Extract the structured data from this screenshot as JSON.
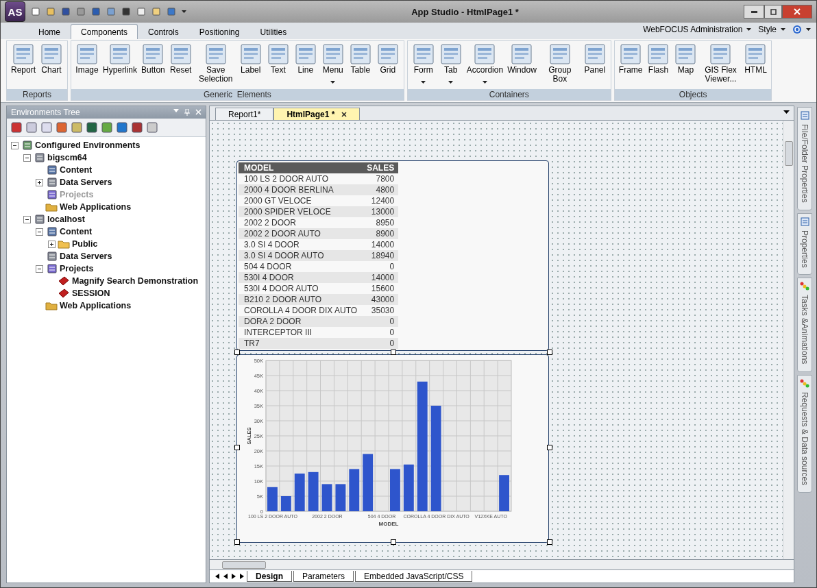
{
  "window": {
    "title": "App Studio - HtmlPage1 *",
    "app_badge": "AS"
  },
  "ribbon_tabs": [
    {
      "label": "Home",
      "selected": false
    },
    {
      "label": "Components",
      "selected": true
    },
    {
      "label": "Controls",
      "selected": false
    },
    {
      "label": "Positioning",
      "selected": false
    },
    {
      "label": "Utilities",
      "selected": false
    }
  ],
  "ribbon_right": [
    {
      "label": "WebFOCUS Administration"
    },
    {
      "label": "Style"
    }
  ],
  "ribbon_groups": [
    {
      "label": "Reports",
      "buttons": [
        {
          "label": "Report",
          "dropdown": false
        },
        {
          "label": "Chart",
          "dropdown": false
        }
      ]
    },
    {
      "label": "Generic  Elements",
      "buttons": [
        {
          "label": "Image",
          "dropdown": false
        },
        {
          "label": "Hyperlink",
          "dropdown": false
        },
        {
          "label": "Button",
          "dropdown": false
        },
        {
          "label": "Reset",
          "dropdown": false
        },
        {
          "label": "Save Selection",
          "dropdown": false
        },
        {
          "label": "Label",
          "dropdown": false
        },
        {
          "label": "Text",
          "dropdown": false
        },
        {
          "label": "Line",
          "dropdown": false
        },
        {
          "label": "Menu",
          "dropdown": true
        },
        {
          "label": "Table",
          "dropdown": false
        },
        {
          "label": "Grid",
          "dropdown": false
        }
      ]
    },
    {
      "label": "Containers",
      "buttons": [
        {
          "label": "Form",
          "dropdown": true
        },
        {
          "label": "Tab",
          "dropdown": true
        },
        {
          "label": "Accordion",
          "dropdown": true
        },
        {
          "label": "Window",
          "dropdown": false
        },
        {
          "label": "Group Box",
          "dropdown": false
        },
        {
          "label": "Panel",
          "dropdown": false
        }
      ]
    },
    {
      "label": "Objects",
      "buttons": [
        {
          "label": "Frame",
          "dropdown": false
        },
        {
          "label": "Flash",
          "dropdown": false
        },
        {
          "label": "Map",
          "dropdown": false
        },
        {
          "label": "GIS Flex Viewer...",
          "dropdown": false
        },
        {
          "label": "HTML",
          "dropdown": false
        }
      ]
    }
  ],
  "env_panel": {
    "title": "Environments Tree",
    "tree": [
      {
        "label": "Configured Environments",
        "kind": "environment",
        "expanded": true,
        "disabled": false,
        "children": [
          {
            "label": "bigscm64",
            "kind": "server",
            "expanded": true,
            "disabled": false,
            "children": [
              {
                "label": "Content",
                "kind": "content",
                "disabled": false
              },
              {
                "label": "Data Servers",
                "kind": "servers",
                "expanded": false,
                "disabled": false
              },
              {
                "label": "Projects",
                "kind": "projects",
                "disabled": true
              },
              {
                "label": "Web Applications",
                "kind": "webapp",
                "disabled": false
              }
            ]
          },
          {
            "label": "localhost",
            "kind": "server",
            "expanded": true,
            "disabled": false,
            "children": [
              {
                "label": "Content",
                "kind": "content",
                "expanded": true,
                "disabled": false,
                "children": [
                  {
                    "label": "Public",
                    "kind": "folder",
                    "expanded": false,
                    "disabled": false
                  }
                ]
              },
              {
                "label": "Data Servers",
                "kind": "servers",
                "disabled": false
              },
              {
                "label": "Projects",
                "kind": "projects",
                "expanded": true,
                "disabled": false,
                "children": [
                  {
                    "label": "Magnify Search Demonstration",
                    "kind": "project",
                    "disabled": false
                  },
                  {
                    "label": "SESSION",
                    "kind": "project",
                    "disabled": false
                  }
                ]
              },
              {
                "label": "Web Applications",
                "kind": "webapp",
                "disabled": false
              }
            ]
          }
        ]
      }
    ]
  },
  "doc_tabs": [
    {
      "label": "Report1*",
      "selected": false
    },
    {
      "label": "HtmlPage1 *",
      "selected": true
    }
  ],
  "report_table": {
    "columns": [
      "MODEL",
      "SALES"
    ],
    "rows": [
      [
        "100 LS 2 DOOR AUTO",
        "7800"
      ],
      [
        "2000 4 DOOR BERLINA",
        "4800"
      ],
      [
        "2000 GT VELOCE",
        "12400"
      ],
      [
        "2000 SPIDER VELOCE",
        "13000"
      ],
      [
        "2002 2 DOOR",
        "8950"
      ],
      [
        "2002 2 DOOR AUTO",
        "8900"
      ],
      [
        "3.0 SI 4 DOOR",
        "14000"
      ],
      [
        "3.0 SI 4 DOOR AUTO",
        "18940"
      ],
      [
        "504 4 DOOR",
        "0"
      ],
      [
        "530I 4 DOOR",
        "14000"
      ],
      [
        "530I 4 DOOR AUTO",
        "15600"
      ],
      [
        "B210 2 DOOR AUTO",
        "43000"
      ],
      [
        "COROLLA 4 DOOR DIX AUTO",
        "35030"
      ],
      [
        "DORA 2 DOOR",
        "0"
      ],
      [
        "INTERCEPTOR III",
        "0"
      ],
      [
        "TR7",
        "0"
      ]
    ]
  },
  "chart": {
    "chart_data": {
      "type": "bar",
      "xlabel": "MODEL",
      "ylabel": "SALES",
      "ylim": [
        0,
        50000
      ],
      "yticks": [
        {
          "value": 0,
          "label": "0"
        },
        {
          "value": 5000,
          "label": "5K"
        },
        {
          "value": 10000,
          "label": "10K"
        },
        {
          "value": 15000,
          "label": "15K"
        },
        {
          "value": 20000,
          "label": "20K"
        },
        {
          "value": 25000,
          "label": "25K"
        },
        {
          "value": 30000,
          "label": "30K"
        },
        {
          "value": 35000,
          "label": "35K"
        },
        {
          "value": 40000,
          "label": "40K"
        },
        {
          "value": 45000,
          "label": "45K"
        },
        {
          "value": 50000,
          "label": "50K"
        }
      ],
      "grid": true,
      "categories": [
        "100 LS 2 DOOR AUTO",
        null,
        null,
        null,
        "2002 2 DOOR",
        null,
        null,
        null,
        "504 4 DOOR",
        null,
        null,
        null,
        "COROLLA 4 DOOR DIX AUTO",
        null,
        null,
        null,
        "V12XKE AUTO",
        null
      ],
      "series": [
        {
          "color": "#2e55cc",
          "values": [
            8000,
            5000,
            12500,
            13000,
            9000,
            9000,
            14000,
            19000,
            0,
            14000,
            15500,
            43000,
            35000,
            0,
            0,
            0,
            0,
            12000
          ]
        }
      ]
    }
  },
  "bottom_tabs": [
    {
      "label": "Design",
      "selected": true
    },
    {
      "label": "Parameters",
      "selected": false
    },
    {
      "label": "Embedded JavaScript/CSS",
      "selected": false
    }
  ],
  "side_tabs": [
    {
      "label": "File/Folder Properties",
      "kind": "properties"
    },
    {
      "label": "Properties",
      "kind": "properties"
    },
    {
      "label": "Tasks &Animations",
      "kind": "tasks"
    },
    {
      "label": "Requests & Data sources",
      "kind": "tasks"
    }
  ]
}
